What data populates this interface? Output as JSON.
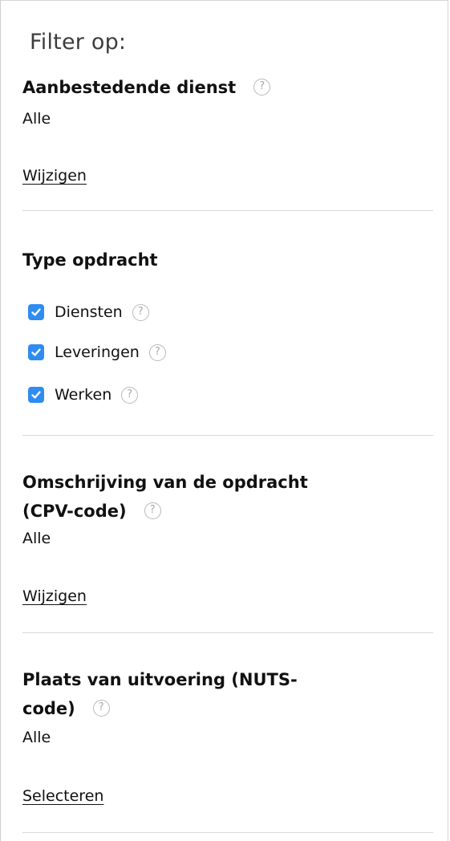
{
  "filter": {
    "title": "Filter op:"
  },
  "sections": {
    "contracting_authority": {
      "heading": "Aanbestedende dienst",
      "value": "Alle",
      "link": "Wijzigen"
    },
    "contract_type": {
      "heading": "Type opdracht",
      "options": [
        {
          "label": "Diensten",
          "checked": true
        },
        {
          "label": "Leveringen",
          "checked": true
        },
        {
          "label": "Werken",
          "checked": true
        }
      ]
    },
    "cpv": {
      "heading_line1": "Omschrijving van de opdracht",
      "heading_line2": "(CPV-code)",
      "value": "Alle",
      "link": "Wijzigen"
    },
    "nuts": {
      "heading_line1": "Plaats van uitvoering (NUTS-",
      "heading_line2": "code)",
      "value": "Alle",
      "link": "Selecteren"
    }
  },
  "icons": {
    "help": "?",
    "check": "checkmark-icon"
  },
  "colors": {
    "checkbox": "#2f8cf1",
    "divider": "#d9d9d9",
    "help_icon": "#b9b9b9"
  }
}
